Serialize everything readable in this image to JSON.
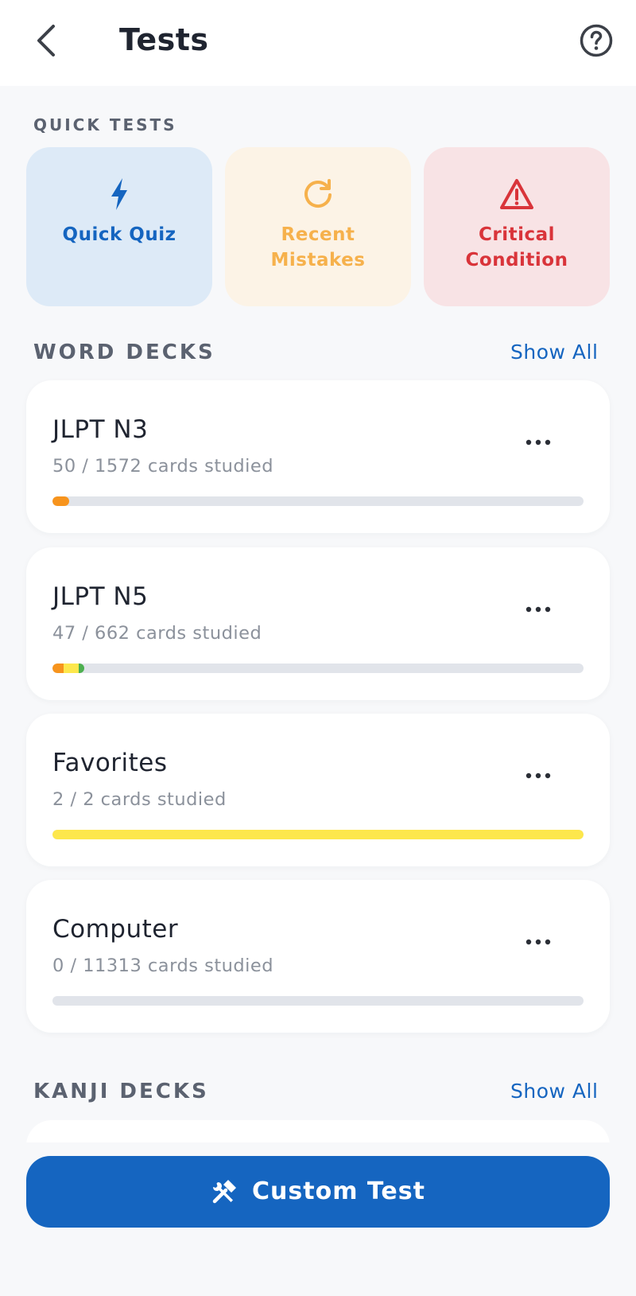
{
  "header": {
    "title": "Tests",
    "back_icon": "chevron-left-icon",
    "help_icon": "question-circle-icon"
  },
  "quick_tests": {
    "label": "QUICK TESTS",
    "items": [
      {
        "label": "Quick Quiz",
        "icon": "lightning-icon",
        "bg": "#ddeaf7",
        "color": "#1565c0"
      },
      {
        "label": "Recent Mistakes",
        "icon": "refresh-icon",
        "bg": "#fcf3e6",
        "color": "#f6b14c"
      },
      {
        "label": "Critical Condition",
        "icon": "warning-icon",
        "bg": "#f8e3e5",
        "color": "#d9343a"
      }
    ]
  },
  "word_decks": {
    "label": "WORD DECKS",
    "show_all": "Show All",
    "items": [
      {
        "name": "JLPT N3",
        "progress_text": "50 / 1572 cards studied",
        "segments": [
          {
            "color": "#f7941d",
            "fraction": 0.032
          }
        ]
      },
      {
        "name": "JLPT N5",
        "progress_text": "47 / 662 cards studied",
        "segments": [
          {
            "color": "#f7941d",
            "fraction": 0.021
          },
          {
            "color": "#fde74c",
            "fraction": 0.028
          },
          {
            "color": "#4caf50",
            "fraction": 0.01
          }
        ]
      },
      {
        "name": "Favorites",
        "progress_text": "2 / 2 cards studied",
        "segments": [
          {
            "color": "#fde74c",
            "fraction": 1.0
          }
        ]
      },
      {
        "name": "Computer",
        "progress_text": "0 / 11313 cards studied",
        "segments": []
      }
    ]
  },
  "kanji_decks": {
    "label": "KANJI DECKS",
    "show_all": "Show All"
  },
  "custom_test": {
    "label": "Custom Test",
    "icon": "tools-icon",
    "color": "#1565c0"
  }
}
